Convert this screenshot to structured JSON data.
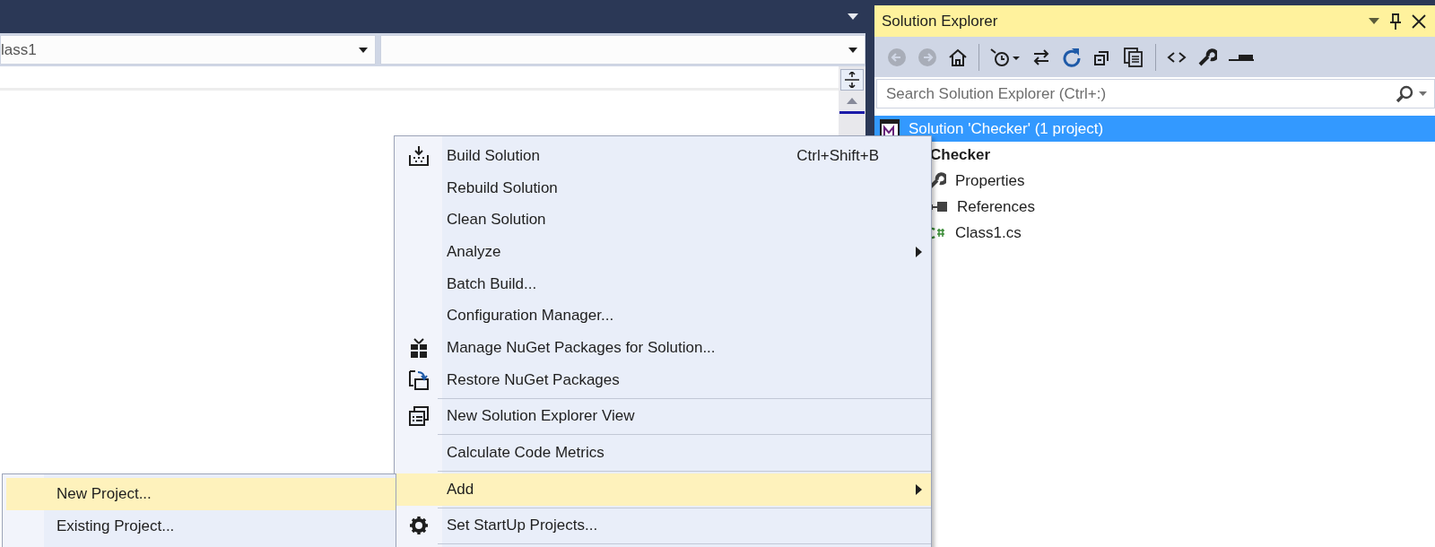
{
  "editor": {
    "type_combo": "lass1"
  },
  "solution_explorer": {
    "title": "Solution Explorer",
    "toolbar": [
      {
        "kind": "back",
        "disabled": true
      },
      {
        "kind": "forward",
        "disabled": true
      },
      {
        "kind": "home",
        "disabled": false
      },
      {
        "kind": "separator"
      },
      {
        "kind": "pending-changes",
        "disabled": false
      },
      {
        "kind": "sync",
        "disabled": false
      },
      {
        "kind": "refresh",
        "disabled": false
      },
      {
        "kind": "collapse",
        "disabled": false
      },
      {
        "kind": "show-all",
        "disabled": false
      },
      {
        "kind": "separator"
      },
      {
        "kind": "view-code",
        "disabled": false
      },
      {
        "kind": "properties",
        "disabled": false
      },
      {
        "kind": "preview",
        "disabled": false
      }
    ],
    "search": {
      "placeholder": "Search Solution Explorer (Ctrl+:)"
    },
    "tree": [
      {
        "label": "Solution 'Checker' (1 project)",
        "kind": "solution",
        "selected": true,
        "children": [
          {
            "label": "Checker",
            "kind": "project",
            "selected": false,
            "children": [
              {
                "label": "Properties",
                "kind": "properties",
                "selected": false
              },
              {
                "label": "References",
                "kind": "references",
                "selected": false
              },
              {
                "label": "Class1.cs",
                "kind": "csharp",
                "selected": false
              }
            ]
          }
        ]
      }
    ]
  },
  "context_menu": {
    "groups": [
      [
        {
          "label": "Build Solution",
          "shortcut": "Ctrl+Shift+B",
          "kind": "build",
          "has_submenu": false,
          "selected": false
        },
        {
          "label": "Rebuild Solution",
          "kind": "plain",
          "has_submenu": false,
          "selected": false
        },
        {
          "label": "Clean Solution",
          "kind": "plain",
          "has_submenu": false,
          "selected": false
        },
        {
          "label": "Analyze",
          "kind": "plain",
          "has_submenu": true,
          "selected": false
        },
        {
          "label": "Batch Build...",
          "kind": "plain",
          "has_submenu": false,
          "selected": false
        },
        {
          "label": "Configuration Manager...",
          "kind": "plain",
          "has_submenu": false,
          "selected": false
        },
        {
          "label": "Manage NuGet Packages for Solution...",
          "kind": "nuget",
          "has_submenu": false,
          "selected": false
        },
        {
          "label": "Restore NuGet Packages",
          "kind": "restore",
          "has_submenu": false,
          "selected": false
        }
      ],
      [
        {
          "label": "New Solution Explorer View",
          "kind": "new-view",
          "has_submenu": false,
          "selected": false
        }
      ],
      [
        {
          "label": "Calculate Code Metrics",
          "kind": "plain",
          "has_submenu": false,
          "selected": false
        }
      ],
      [
        {
          "label": "Add",
          "kind": "plain",
          "has_submenu": true,
          "selected": true
        }
      ],
      [
        {
          "label": "Set StartUp Projects...",
          "kind": "gear",
          "has_submenu": false,
          "selected": false
        }
      ]
    ]
  },
  "add_submenu": {
    "items": [
      {
        "label": "New Project...",
        "selected": true
      },
      {
        "label": "Existing Project...",
        "selected": false
      }
    ]
  }
}
